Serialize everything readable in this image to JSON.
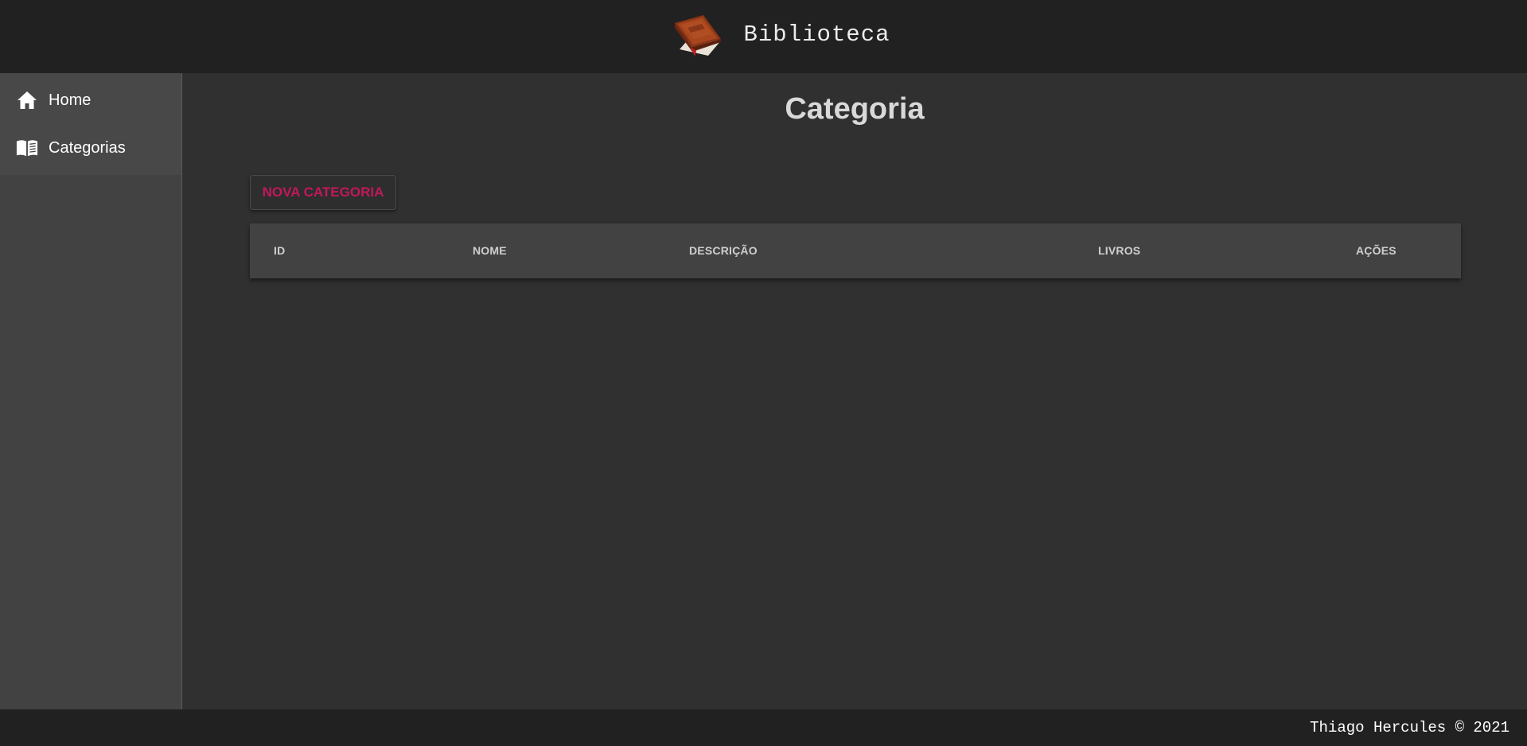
{
  "header": {
    "title": "Biblioteca",
    "logo_icon": "book-icon"
  },
  "sidebar": {
    "items": [
      {
        "label": "Home",
        "icon": "home-icon"
      },
      {
        "label": "Categorias",
        "icon": "open-book-icon"
      }
    ]
  },
  "main": {
    "title": "Categoria",
    "new_button_label": "NOVA CATEGORIA",
    "table": {
      "columns": [
        "ID",
        "NOME",
        "DESCRIÇÃO",
        "LIVROS",
        "AÇÕES"
      ],
      "rows": []
    }
  },
  "footer": {
    "text": "Thiago Hercules © 2021"
  },
  "colors": {
    "accent": "#c2185b",
    "header_bg": "#212121",
    "sidebar_bg": "#424242",
    "main_bg": "#303030"
  }
}
